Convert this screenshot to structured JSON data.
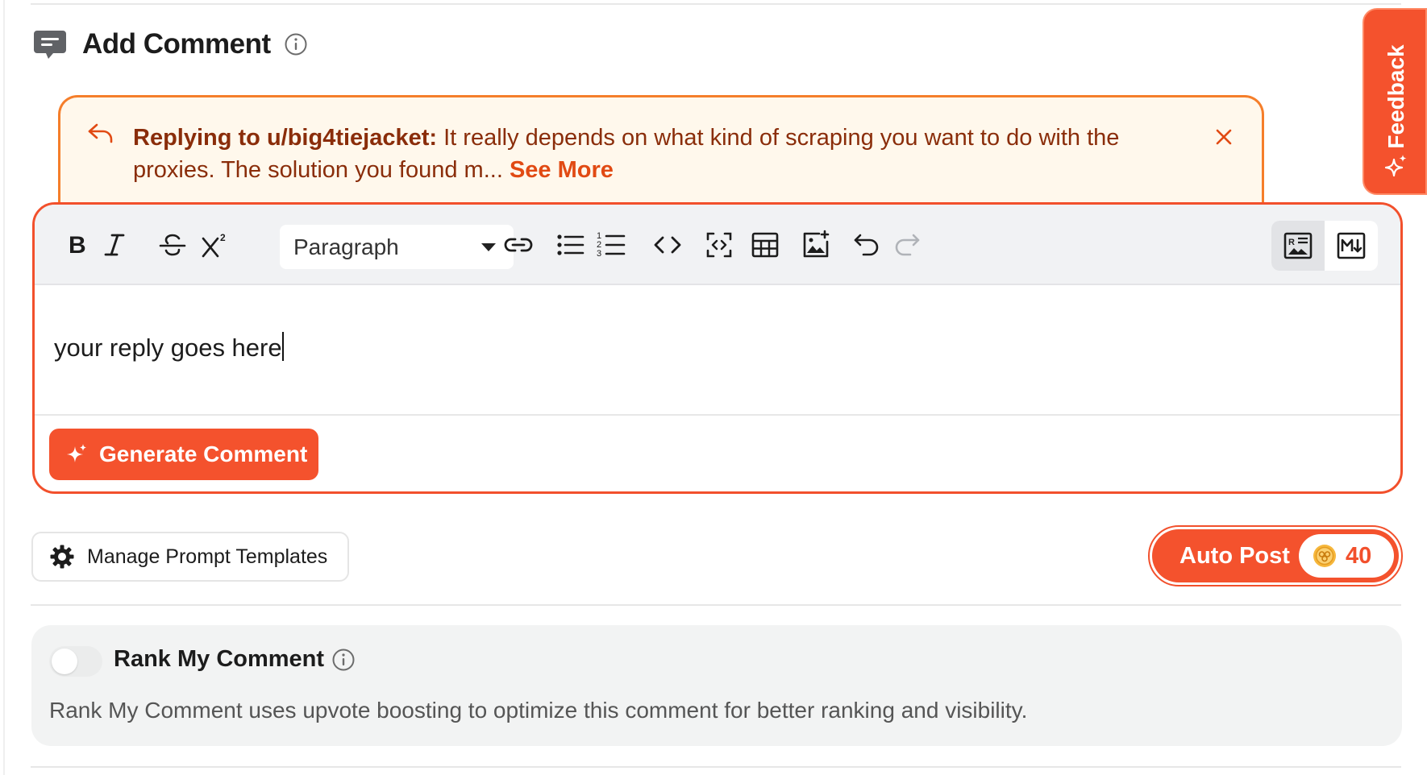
{
  "header": {
    "title": "Add Comment",
    "chat_icon": "chat-bubble-icon",
    "info_icon": "info-icon"
  },
  "reply": {
    "prefix": "Replying to u/big4tiejacket:",
    "excerpt": " It really depends on what kind of scraping you want to do with the proxies. The solution you found m... ",
    "see_more": "See More"
  },
  "editor": {
    "block_format": "Paragraph",
    "content": "your reply goes here",
    "toolbar_icons": [
      "bold-icon",
      "italic-icon",
      "strikethrough-icon",
      "superscript-icon",
      "link-icon",
      "bullet-list-icon",
      "numbered-list-icon",
      "code-icon",
      "code-block-icon",
      "table-icon",
      "image-icon",
      "undo-icon",
      "redo-icon"
    ],
    "modes": [
      "rich-text-icon",
      "markdown-icon"
    ],
    "active_mode": "rich-text"
  },
  "actions": {
    "generate_label": "Generate Comment",
    "templates_label": "Manage Prompt Templates",
    "autopost_label": "Auto Post",
    "credits": "40"
  },
  "rank": {
    "title": "Rank My Comment",
    "enabled": false,
    "description": "Rank My Comment uses upvote boosting to optimize this comment for better ranking and visibility."
  },
  "feedback": {
    "label": "Feedback"
  },
  "colors": {
    "accent": "#f4522d",
    "banner_border": "#f57e2a",
    "banner_bg": "#fff8ec",
    "banner_text": "#8a2d0a"
  }
}
